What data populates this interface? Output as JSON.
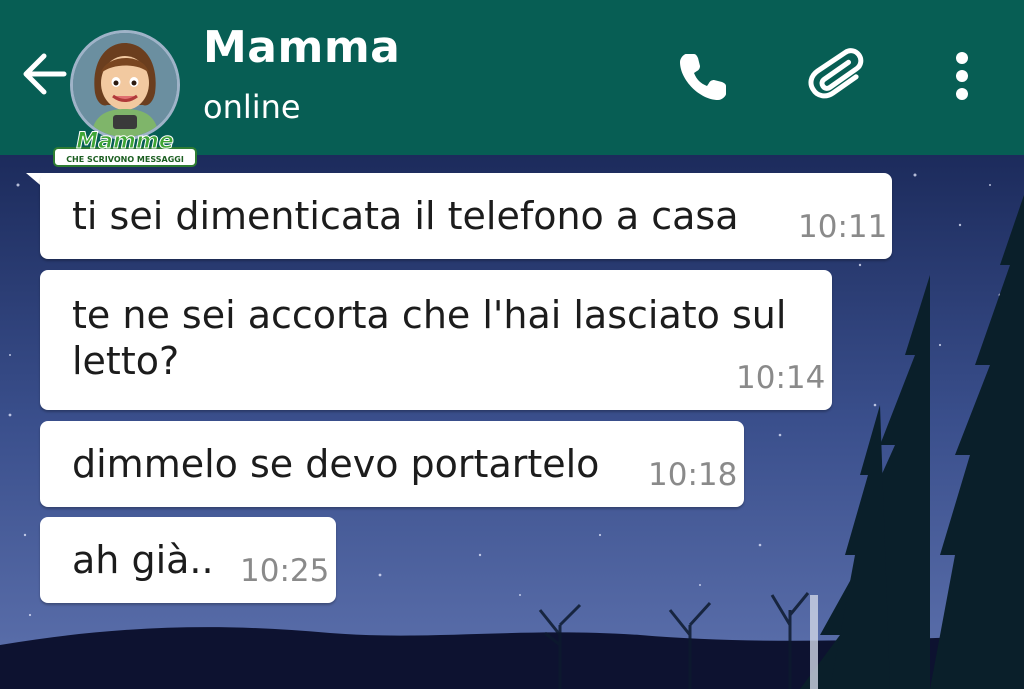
{
  "header": {
    "contact_name": "Mamma",
    "status": "online",
    "background_color": "#075e54",
    "logo_text": "Mamme",
    "logo_subtext": "CHE SCRIVONO MESSAGGI",
    "icons": {
      "back": "arrow-left-icon",
      "call": "phone-icon",
      "attach": "paperclip-icon",
      "menu": "more-vertical-icon"
    }
  },
  "messages": [
    {
      "text": "ti sei dimenticata il telefono a casa",
      "time": "10:11"
    },
    {
      "text": "te ne sei accorta che l'hai lasciato sul\nletto?",
      "time": "10:14"
    },
    {
      "text": "dimmelo se devo portartelo",
      "time": "10:18"
    },
    {
      "text": "ah già..",
      "time": "10:25"
    }
  ]
}
